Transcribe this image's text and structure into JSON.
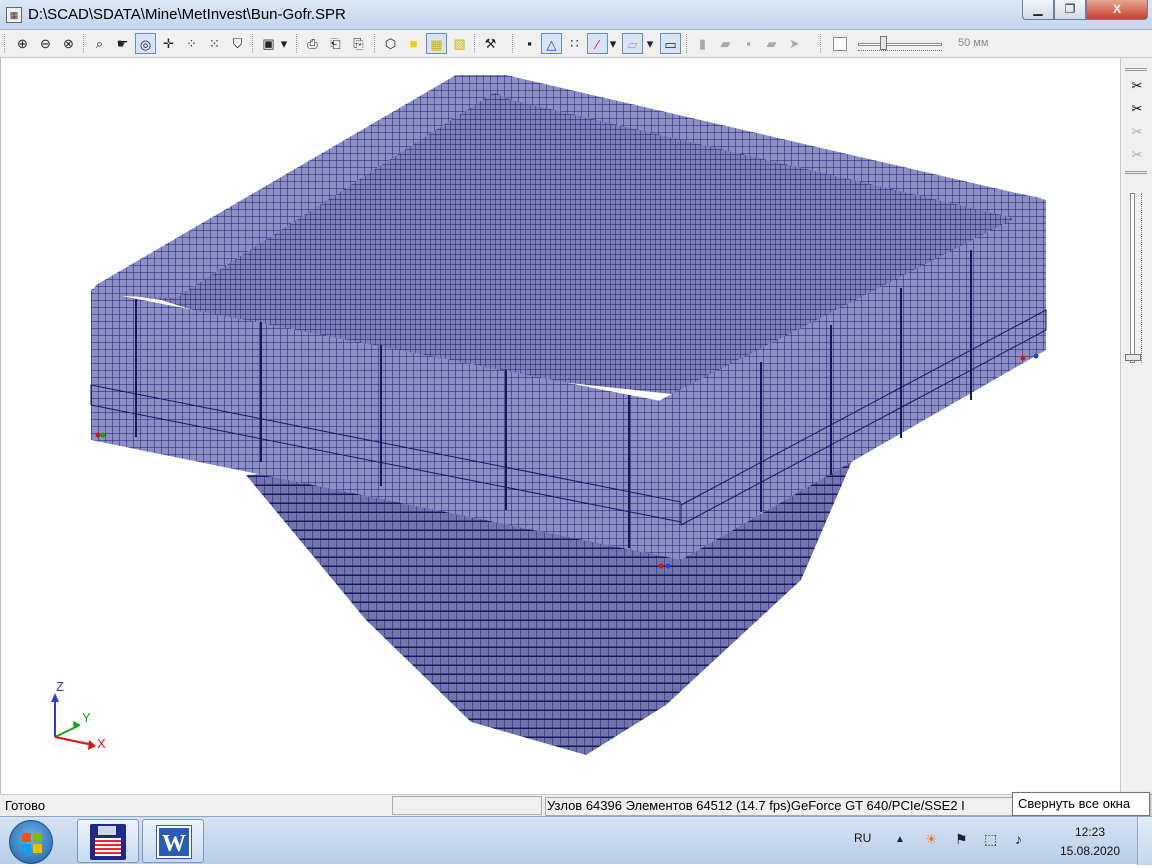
{
  "window": {
    "title": "D:\\SCAD\\SDATA\\Mine\\MetInvest\\Bun-Gofr.SPR",
    "minimize_icon": "minimize-icon",
    "maximize_icon": "restore-icon",
    "close_icon": "close-icon",
    "min_glyph": "▁",
    "max_glyph": "❐",
    "close_glyph": "X"
  },
  "toolbar": {
    "icons": [
      {
        "name": "zoom-in-icon",
        "glyph": "⊕"
      },
      {
        "name": "zoom-out-icon",
        "glyph": "⊖"
      },
      {
        "name": "zoom-fit-icon",
        "glyph": "⊗"
      },
      {
        "name": "zoom-window-icon",
        "glyph": "⌕"
      },
      {
        "name": "pan-icon",
        "glyph": "☛"
      },
      {
        "name": "rotate-icon",
        "glyph": "◎"
      },
      {
        "name": "move-icon",
        "glyph": "✛"
      },
      {
        "name": "select-nodes-icon",
        "glyph": "⁘"
      },
      {
        "name": "select-elements-icon",
        "glyph": "⁙"
      },
      {
        "name": "shield-icon",
        "glyph": "⛉"
      },
      {
        "name": "cube-view-icon",
        "glyph": "▣"
      },
      {
        "name": "dropdown-icon",
        "glyph": "▾"
      },
      {
        "name": "print-icon",
        "glyph": "⎙"
      },
      {
        "name": "print-preview-icon",
        "glyph": "⎗"
      },
      {
        "name": "dxf-export-icon",
        "glyph": "⎘"
      },
      {
        "name": "wireframe-cube-icon",
        "glyph": "⬡"
      },
      {
        "name": "yellow-cube-icon",
        "glyph": "■"
      },
      {
        "name": "shaded-cube-icon",
        "glyph": "▦"
      },
      {
        "name": "solid-cube-icon",
        "glyph": "▧"
      },
      {
        "name": "tools-icon",
        "glyph": "⚒"
      },
      {
        "name": "node-icon",
        "glyph": "▪"
      },
      {
        "name": "triangle-node-icon",
        "glyph": "△"
      },
      {
        "name": "grid-nodes-icon",
        "glyph": "∷"
      },
      {
        "name": "bar-element-icon",
        "glyph": "∕"
      },
      {
        "name": "dropdown-icon",
        "glyph": "▾"
      },
      {
        "name": "plate-element-icon",
        "glyph": "▱"
      },
      {
        "name": "dropdown-icon",
        "glyph": "▾"
      },
      {
        "name": "solid-element-icon",
        "glyph": "▭"
      },
      {
        "name": "filter-1-icon",
        "glyph": "▮"
      },
      {
        "name": "filter-2-icon",
        "glyph": "▰"
      },
      {
        "name": "filter-3-icon",
        "glyph": "▪"
      },
      {
        "name": "filter-4-icon",
        "glyph": "▰"
      },
      {
        "name": "filter-5-icon",
        "glyph": "➤"
      }
    ],
    "slider": {
      "value_label": "50 мм",
      "level": 0.3
    }
  },
  "right_toolbar": {
    "icons": [
      {
        "name": "scissors-icon",
        "glyph": "✂"
      },
      {
        "name": "scissors-icon",
        "glyph": "✂"
      },
      {
        "name": "scissors-disabled-icon",
        "glyph": "✂"
      },
      {
        "name": "scissors-disabled-icon",
        "glyph": "✂"
      }
    ],
    "slider_level": 0.95
  },
  "axes": {
    "z": "Z",
    "y": "Y",
    "x": "X"
  },
  "colors": {
    "mesh_fill": "#8c8fc4",
    "mesh_line": "#1a1f6e",
    "shadow": "#5d6099"
  },
  "status": {
    "ready": "Готово",
    "info": "Узлов 64396  Элементов 64512  (14.7 fps)GeForce GT 640/PCIe/SSE2 I"
  },
  "tooltip": "Свернуть все окна",
  "taskbar": {
    "start_icon": "windows-start-icon",
    "buttons": [
      {
        "name": "floppy-app-icon"
      },
      {
        "name": "word-app-icon",
        "glyph": "W"
      }
    ],
    "tray": {
      "lang": "RU",
      "icons": [
        {
          "name": "show-hidden-icons",
          "glyph": "▲"
        },
        {
          "name": "avast-icon",
          "glyph": "☀"
        },
        {
          "name": "flag-icon",
          "glyph": "⚑"
        },
        {
          "name": "network-icon",
          "glyph": "⬚"
        },
        {
          "name": "volume-icon",
          "glyph": "♪"
        }
      ],
      "time": "12:23",
      "date": "15.08.2020"
    }
  }
}
